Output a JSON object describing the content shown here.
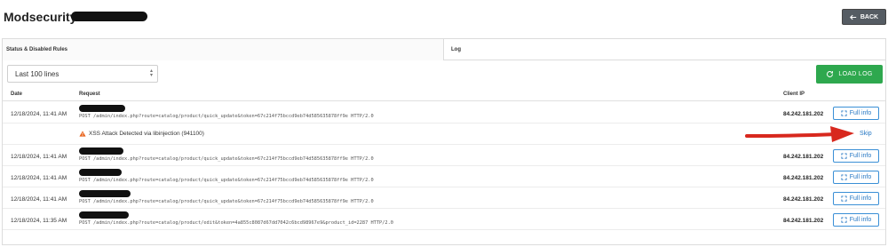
{
  "header": {
    "title": "Modsecurity:",
    "back_label": "BACK"
  },
  "tabs": [
    {
      "label": "Status & Disabled Rules"
    },
    {
      "label": "Log"
    }
  ],
  "controls": {
    "lines_selected": "Last 100 lines",
    "load_label": "LOAD LOG"
  },
  "table": {
    "columns": {
      "date": "Date",
      "request": "Request",
      "ip": "Client IP"
    },
    "rows": [
      {
        "date": "12/18/2024, 11:41 AM",
        "request": "POST /admin/index.php?route=catalog/product/quick_update&token=67c214f75bccd9eb74d585635878ff9e HTTP/2.0",
        "ip": "84.242.181.202",
        "info_label": "Full info"
      },
      {
        "date": "12/18/2024, 11:41 AM",
        "request": "POST /admin/index.php?route=catalog/product/quick_update&token=67c214f75bccd9eb74d585635878ff9e HTTP/2.0",
        "ip": "84.242.181.202",
        "info_label": "Full info"
      },
      {
        "date": "12/18/2024, 11:41 AM",
        "request": "POST /admin/index.php?route=catalog/product/quick_update&token=67c214f75bccd9eb74d585635878ff9e HTTP/2.0",
        "ip": "84.242.181.202",
        "info_label": "Full info"
      },
      {
        "date": "12/18/2024, 11:41 AM",
        "request": "POST /admin/index.php?route=catalog/product/quick_update&token=67c214f75bccd9eb74d585635878ff9e HTTP/2.0",
        "ip": "84.242.181.202",
        "info_label": "Full info"
      },
      {
        "date": "12/18/2024, 11:35 AM",
        "request": "POST /admin/index.php?route=catalog/product/edit&token=4a855c8087d67dd7042c6bcd98967e9&product_id=2287 HTTP/2.0",
        "ip": "84.242.181.202",
        "info_label": "Full info"
      }
    ],
    "alert": {
      "text": "XSS Attack Detected via libinjection (941100)",
      "skip_label": "Skip"
    }
  },
  "colors": {
    "load_button": "#2ea84e",
    "back_button": "#555c63",
    "link": "#2778c4",
    "annotation_arrow": "#d8281e"
  }
}
